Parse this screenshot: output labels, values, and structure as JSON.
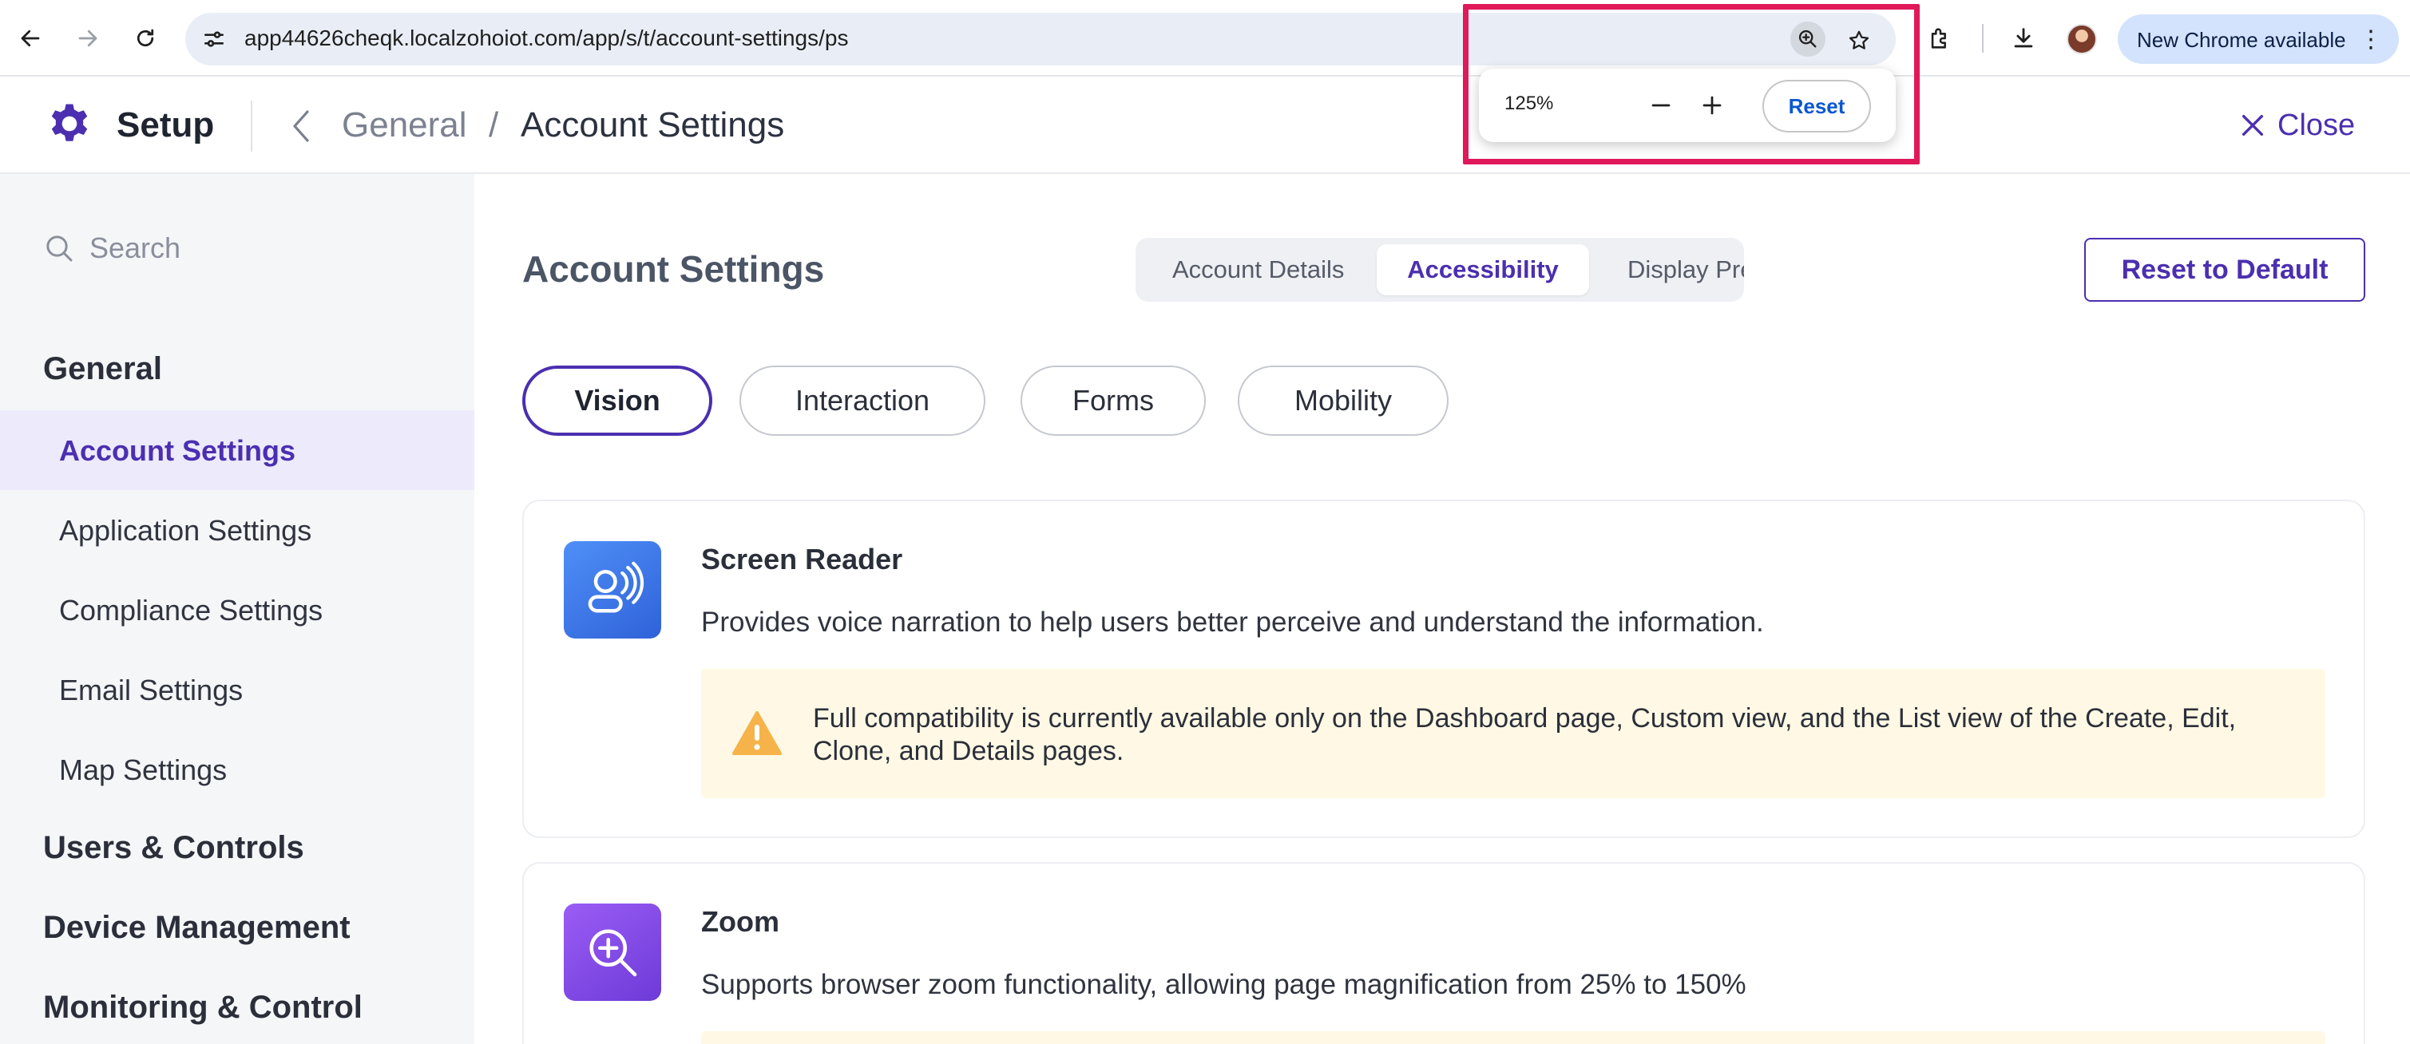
{
  "browser": {
    "url": "app44626cheqk.localzohoiot.com/app/s/t/account-settings/ps",
    "update_pill_label": "New Chrome available",
    "zoom_popup": {
      "level": "125%",
      "reset_label": "Reset"
    }
  },
  "header": {
    "app_title": "Setup",
    "breadcrumb_parent": "General",
    "breadcrumb_separator": "/",
    "breadcrumb_current": "Account Settings",
    "close_label": "Close",
    "accent_color": "#4b2fb0"
  },
  "sidebar": {
    "search_placeholder": "Search",
    "groups": [
      {
        "label": "General",
        "items": [
          {
            "label": "Account Settings",
            "active": true
          },
          {
            "label": "Application Settings"
          },
          {
            "label": "Compliance Settings"
          },
          {
            "label": "Email Settings"
          },
          {
            "label": "Map Settings"
          }
        ]
      },
      {
        "label": "Users & Controls"
      },
      {
        "label": "Device Management"
      },
      {
        "label": "Monitoring & Control"
      }
    ]
  },
  "main": {
    "page_title": "Account Settings",
    "tabs": [
      {
        "label": "Account Details"
      },
      {
        "label": "Accessibility",
        "active": true
      },
      {
        "label": "Display Pre"
      }
    ],
    "reset_default_label": "Reset to Default",
    "categories": [
      {
        "label": "Vision",
        "active": true
      },
      {
        "label": "Interaction"
      },
      {
        "label": "Forms"
      },
      {
        "label": "Mobility"
      }
    ],
    "cards": [
      {
        "icon": "screen-reader-icon",
        "title": "Screen Reader",
        "description": "Provides voice narration to help users better perceive and understand the information.",
        "notice": "Full compatibility is currently available only on the Dashboard page, Custom view, and the List view of the Create, Edit, Clone, and Details pages."
      },
      {
        "icon": "zoom-icon",
        "title": "Zoom",
        "description": "Supports browser zoom functionality, allowing page magnification from 25% to 150%"
      }
    ]
  }
}
